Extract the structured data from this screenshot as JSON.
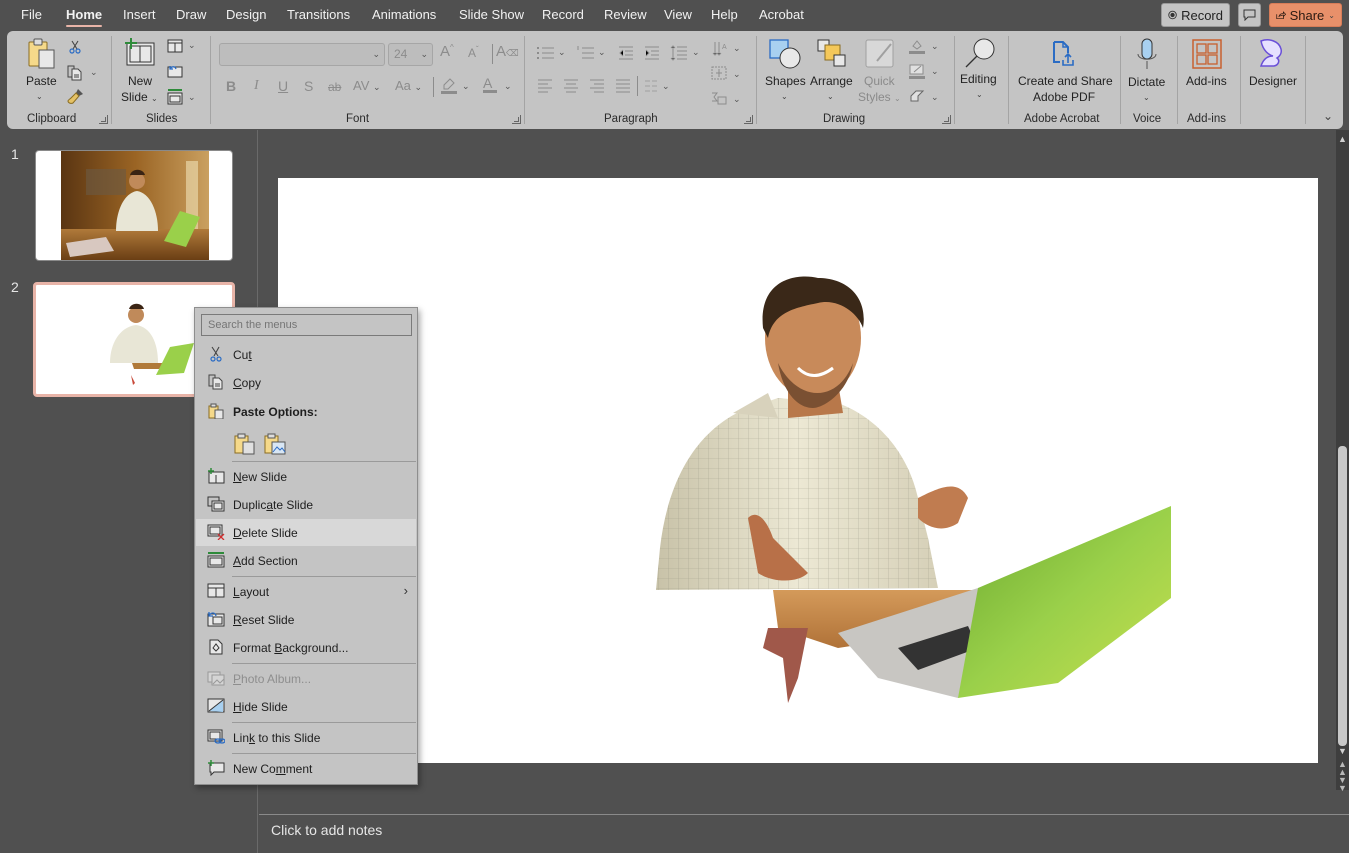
{
  "menubar": {
    "tabs": [
      "File",
      "Home",
      "Insert",
      "Draw",
      "Design",
      "Transitions",
      "Animations",
      "Slide Show",
      "Record",
      "Review",
      "View",
      "Help",
      "Acrobat"
    ],
    "active_tab": "Home",
    "record_label": "Record",
    "share_label": "Share"
  },
  "ribbon": {
    "clipboard": {
      "paste": "Paste",
      "group": "Clipboard"
    },
    "slides": {
      "new_slide_1": "New",
      "new_slide_2": "Slide",
      "group": "Slides"
    },
    "font": {
      "font_name": "",
      "font_size": "24",
      "group": "Font",
      "bold": "B",
      "italic": "I",
      "underline": "U",
      "shadow": "S",
      "strike": "ab",
      "spacing": "AV",
      "case": "Aa"
    },
    "paragraph": {
      "group": "Paragraph"
    },
    "drawing": {
      "shapes": "Shapes",
      "arrange": "Arrange",
      "quick_styles_1": "Quick",
      "quick_styles_2": "Styles",
      "group": "Drawing"
    },
    "editing": {
      "label": "Editing"
    },
    "acrobat": {
      "label_1": "Create and Share",
      "label_2": "Adobe PDF",
      "group": "Adobe Acrobat"
    },
    "voice": {
      "label": "Dictate",
      "group": "Voice"
    },
    "addins": {
      "label": "Add-ins",
      "group": "Add-ins"
    },
    "designer": {
      "label": "Designer"
    }
  },
  "slides_pane": {
    "slides": [
      {
        "number": "1",
        "selected": false
      },
      {
        "number": "2",
        "selected": true
      }
    ]
  },
  "context_menu": {
    "search_placeholder": "Search the menus",
    "items": [
      {
        "id": "cut",
        "label": "Cut",
        "accel": "t",
        "icon": "scissors-icon"
      },
      {
        "id": "copy",
        "label": "Copy",
        "accel": "C",
        "icon": "copy-icon"
      },
      {
        "id": "paste-options",
        "label": "Paste Options:",
        "icon": "paste-icon"
      },
      {
        "id": "new-slide",
        "label": "New Slide",
        "accel": "N",
        "icon": "new-slide-icon"
      },
      {
        "id": "duplicate-slide",
        "label": "Duplicate Slide",
        "accel": "a",
        "icon": "duplicate-slide-icon"
      },
      {
        "id": "delete-slide",
        "label": "Delete Slide",
        "accel": "D",
        "icon": "delete-slide-icon",
        "hover": true
      },
      {
        "id": "add-section",
        "label": "Add Section",
        "accel": "A",
        "icon": "add-section-icon"
      },
      {
        "id": "layout",
        "label": "Layout",
        "accel": "L",
        "icon": "layout-icon",
        "submenu": true
      },
      {
        "id": "reset-slide",
        "label": "Reset Slide",
        "accel": "R",
        "icon": "reset-slide-icon"
      },
      {
        "id": "format-background",
        "label": "Format Background...",
        "accel": "B",
        "icon": "format-background-icon"
      },
      {
        "id": "photo-album",
        "label": "Photo Album...",
        "accel": "P",
        "icon": "photo-album-icon",
        "disabled": true
      },
      {
        "id": "hide-slide",
        "label": "Hide Slide",
        "accel": "H",
        "icon": "hide-slide-icon"
      },
      {
        "id": "link-to-slide",
        "label": "Link to this Slide",
        "accel": "k",
        "icon": "link-slide-icon"
      },
      {
        "id": "new-comment",
        "label": "New Comment",
        "accel": "m",
        "icon": "new-comment-icon"
      }
    ]
  },
  "notes": {
    "placeholder": "Click to add notes"
  },
  "colors": {
    "accent": "#e8906a",
    "selection": "#e8b4a8",
    "ribbon_bg": "#c4c4c4",
    "app_bg": "#505050"
  }
}
